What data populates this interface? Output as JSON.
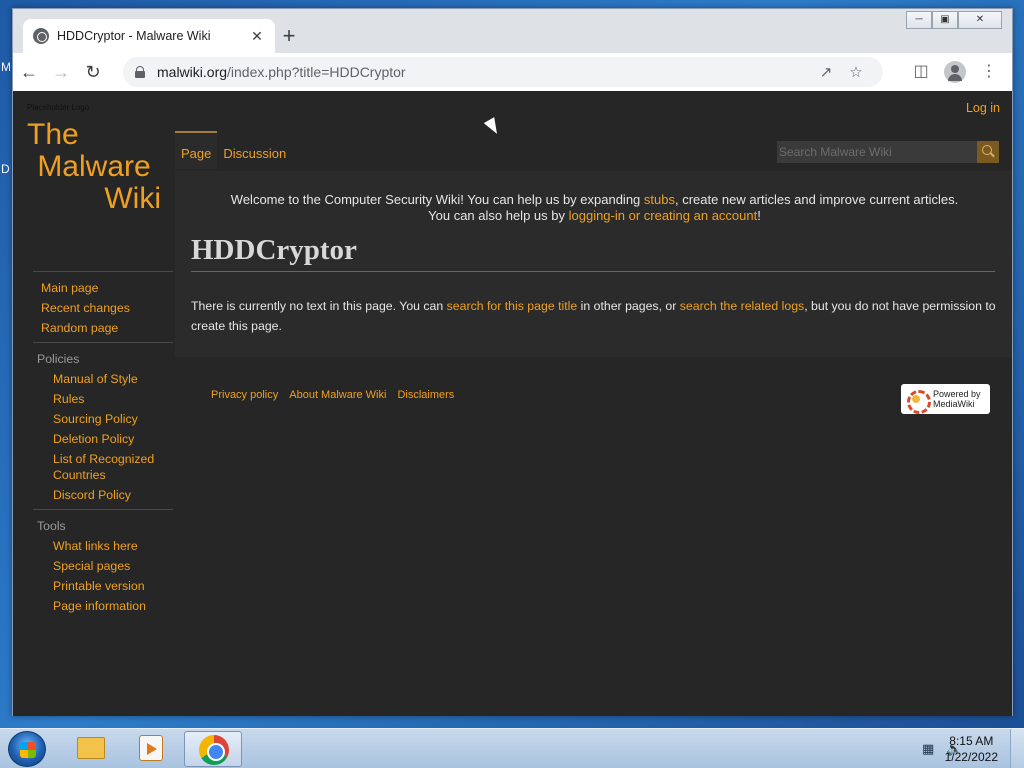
{
  "desktop": {
    "letters": [
      "M",
      "D"
    ]
  },
  "browser": {
    "tab_title": "HDDCryptor - Malware Wiki",
    "tab_close": "✕",
    "new_tab": "+",
    "url_host": "malwiki.org",
    "url_path": "/index.php?title=HDDCryptor",
    "window_controls": [
      "minimize",
      "maximize",
      "close"
    ]
  },
  "wiki": {
    "placeholder_logo": "Placeholder Logo",
    "logo_lines": [
      "The",
      "Malware",
      "Wiki"
    ],
    "login": "Log in",
    "nav_main": [
      "Main page",
      "Recent changes",
      "Random page"
    ],
    "policies_heading": "Policies",
    "policies": [
      "Manual of Style",
      "Rules",
      "Sourcing Policy",
      "Deletion Policy",
      "List of Recognized Countries",
      "Discord Policy"
    ],
    "tools_heading": "Tools",
    "tools": [
      "What links here",
      "Special pages",
      "Printable version",
      "Page information"
    ],
    "tabs": [
      "Page",
      "Discussion"
    ],
    "search_placeholder": "Search Malware Wiki",
    "notice": {
      "line1_pre": "Welcome to the Computer Security Wiki! You can help us by expanding ",
      "line1_link": "stubs",
      "line1_post": ", create new articles and improve current articles.",
      "line2_pre": "You can also help us by ",
      "line2_link": "logging-in or creating an account",
      "line2_post": "!"
    },
    "title": "HDDCryptor",
    "body": {
      "pre": "There is currently no text in this page. You can ",
      "link1": "search for this page title",
      "mid": " in other pages, or ",
      "link2": "search the related logs",
      "post": ", but you do not have permission to create this page."
    },
    "footer_links": [
      "Privacy policy",
      "About Malware Wiki",
      "Disclaimers"
    ],
    "powered_line1": "Powered by",
    "powered_line2": "MediaWiki"
  },
  "taskbar": {
    "time": "8:15 AM",
    "date": "1/22/2022",
    "apps": [
      "explorer",
      "media-player",
      "chrome"
    ]
  },
  "colors": {
    "accent": "#f0a020",
    "page_bg": "#262626",
    "content_bg": "#2b2b2b"
  }
}
